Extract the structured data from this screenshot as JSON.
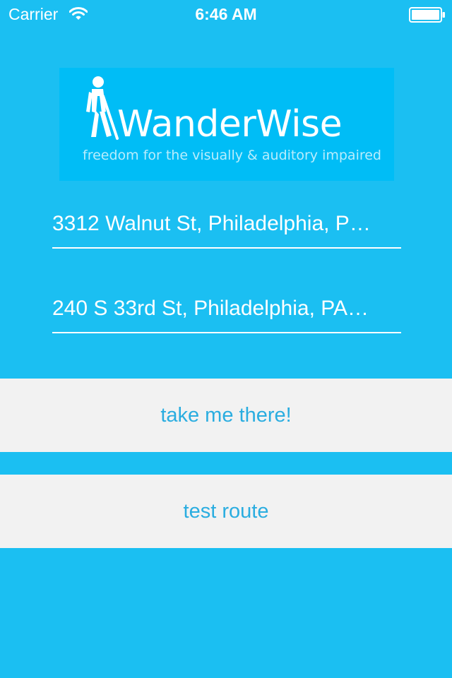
{
  "status_bar": {
    "carrier": "Carrier",
    "time": "6:46 AM",
    "wifi_icon": "wifi-icon",
    "battery_icon": "battery-icon"
  },
  "logo": {
    "icon": "walking-person-icon",
    "name": "WanderWise",
    "tagline": "freedom for the visually & auditory impaired"
  },
  "form": {
    "origin_value": "3312 Walnut St, Philadelphia, P…",
    "destination_value": "240 S 33rd St, Philadelphia, PA…"
  },
  "buttons": {
    "take_me_there": "take me there!",
    "test_route": "test route"
  },
  "colors": {
    "background": "#1bbff2",
    "logo_background": "#00bdf6",
    "button_background": "#f2f2f2",
    "button_text": "#2aade0",
    "text": "#ffffff"
  }
}
